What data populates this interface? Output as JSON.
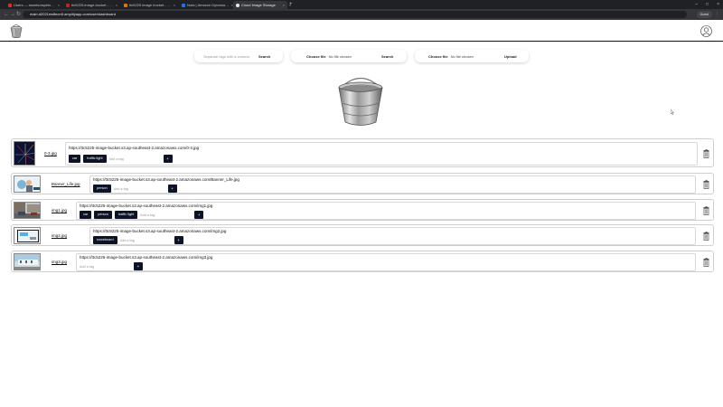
{
  "browser": {
    "tabs": [
      {
        "label": "Users — assets/aspiring(60)",
        "color": "#d93025",
        "active": false
      },
      {
        "label": "ttc5225-image-bucket - S3 bucket",
        "color": "#c5221f",
        "active": false
      },
      {
        "label": "ttc5225 image bucket - S3 buc",
        "color": "#e37400",
        "active": false
      },
      {
        "label": "Nota | Amazon DynamoDB M",
        "color": "#1a73e8",
        "active": false
      },
      {
        "label": "AWS Amplify | ap-southeast-2",
        "color": "#c5221f",
        "active": false
      },
      {
        "label": "Cloud Image Storage",
        "color": "#e8eaed",
        "active": true
      }
    ],
    "new_tab": "+",
    "url": "main.d2021ewlfnon5.amplifyapp.com/user/dashboard",
    "profile_label": "Guest",
    "back_icon": "arrow-left-icon",
    "forward_icon": "arrow-right-icon",
    "reload_icon": "reload-icon"
  },
  "controls": {
    "tag_search": {
      "placeholder": "Separate tags with a comma",
      "button": "Search"
    },
    "file_search": {
      "choose": "Choose file",
      "status": "No file chosen",
      "button": "Search"
    },
    "file_upload": {
      "choose": "Choose file",
      "status": "No file chosen",
      "button": "Upload"
    }
  },
  "images": [
    {
      "filename": "0-3.jpg",
      "url": "https://ttc5225-image-bucket.s3.ap-southeast-2.amazonaws.com/0-3.jpg",
      "tags": [
        "car",
        "traffic light"
      ],
      "add_placeholder": "Add a tag",
      "add_label": "+"
    },
    {
      "filename": "Banner_Life.jpg",
      "url": "https://ttc5225-image-bucket.s3.ap-southeast-2.amazonaws.com/Banner_Life.jpg",
      "tags": [
        "person"
      ],
      "add_placeholder": "Add a tag",
      "add_label": "+"
    },
    {
      "filename": "img1.jpg",
      "url": "https://ttc5225-image-bucket.s3.ap-southeast-2.amazonaws.com/img1.jpg",
      "tags": [
        "car",
        "person",
        "traffic light"
      ],
      "add_placeholder": "Add a tag",
      "add_label": "+"
    },
    {
      "filename": "img2.jpg",
      "url": "https://ttc5225-image-bucket.s3.ap-southeast-2.amazonaws.com/img2.jpg",
      "tags": [
        "snowboard"
      ],
      "add_placeholder": "Add a tag",
      "add_label": "+"
    },
    {
      "filename": "img3.jpg",
      "url": "https://ttc5225-image-bucket.s3.ap-southeast-2.amazonaws.com/img3.jpg",
      "tags": [],
      "add_placeholder": "Add a tag",
      "add_label": "+"
    }
  ],
  "icons": {
    "logo": "bucket-icon",
    "avatar": "user-avatar-icon",
    "delete": "trash-icon"
  },
  "colors": {
    "tag_bg": "#0d1326",
    "chrome_dark": "#202124",
    "chrome_toolbar": "#35363a"
  }
}
